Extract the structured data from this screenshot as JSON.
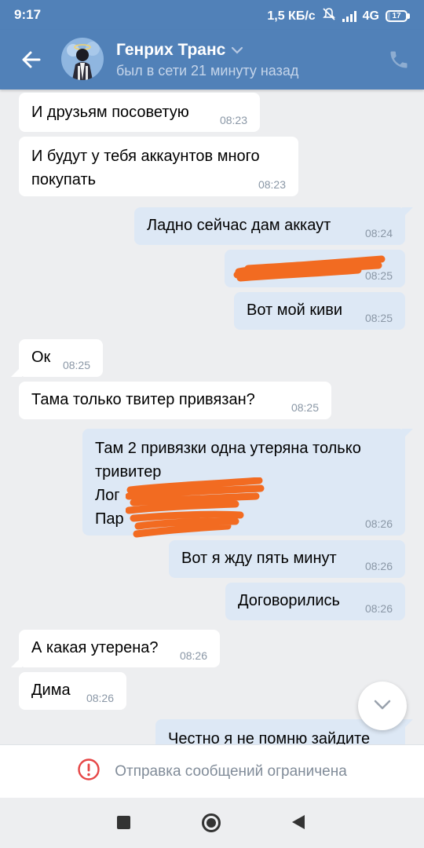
{
  "status_bar": {
    "time": "9:17",
    "network_speed": "1,5 КБ/с",
    "network_type": "4G",
    "battery": "17",
    "battery_level_percent": 17
  },
  "header": {
    "contact_name": "Генрих Транс",
    "contact_status": "был в сети 21 минуту назад"
  },
  "messages": [
    {
      "text": "И друзьям посоветую",
      "time": "08:23",
      "direction": "in"
    },
    {
      "text": "И будут у тебя аккаунтов много покупать",
      "time": "08:23",
      "direction": "in"
    },
    {
      "text": "Ладно сейчас дам аккаут",
      "time": "08:24",
      "direction": "out"
    },
    {
      "text": "",
      "time": "08:25",
      "direction": "out",
      "redacted": true
    },
    {
      "text": "Вот мой киви",
      "time": "08:25",
      "direction": "out"
    },
    {
      "text": "Ок",
      "time": "08:25",
      "direction": "in"
    },
    {
      "text": "Тама только твитер привязан?",
      "time": "08:25",
      "direction": "in"
    },
    {
      "lines": [
        "Там 2 привязки одна утеряна только",
        "тривитер",
        "Лог",
        "Пар"
      ],
      "time": "08:26",
      "direction": "out",
      "redacted": true
    },
    {
      "text": "Вот я жду пять минут",
      "time": "08:26",
      "direction": "out"
    },
    {
      "text": "Договорились",
      "time": "08:26",
      "direction": "out"
    },
    {
      "text": "А какая утерена?",
      "time": "08:26",
      "direction": "in"
    },
    {
      "text": "Дима",
      "time": "08:26",
      "direction": "in"
    },
    {
      "text": "Честно я не помню зайдите",
      "time": "",
      "direction": "out"
    }
  ],
  "footer": {
    "restricted_text": "Отправка сообщений ограничена"
  },
  "colors": {
    "header": "#5181b8",
    "outgoing_bubble": "#dde8f5",
    "incoming_bubble": "#ffffff",
    "background": "#edeef0",
    "redaction": "#f26b21",
    "warning": "#e64646"
  },
  "icons": [
    "back-arrow-icon",
    "chevron-down-icon",
    "phone-icon",
    "scroll-down-icon",
    "warning-icon",
    "recent-apps-icon",
    "home-icon",
    "nav-back-icon"
  ]
}
